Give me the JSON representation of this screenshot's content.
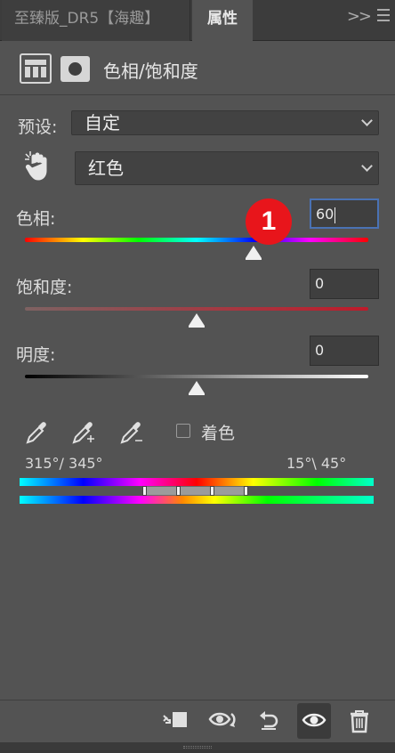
{
  "tabs": [
    {
      "label": "至臻版_DR5【海趣】",
      "active": false
    },
    {
      "label": "属性",
      "active": true
    }
  ],
  "tab_overflow": ">>",
  "panel": {
    "title": "色相/饱和度",
    "icons": [
      "adjustment-layer-icon",
      "layer-mask-icon"
    ]
  },
  "preset": {
    "label": "预设:",
    "value": "自定"
  },
  "channel": {
    "icon": "targeted-adjustment-hand-icon",
    "value": "红色"
  },
  "hue": {
    "label": "色相:",
    "value": "60",
    "level": 60,
    "range": [
      -180,
      180
    ]
  },
  "saturation": {
    "label": "饱和度:",
    "value": "0",
    "level": 0,
    "range": [
      -100,
      100
    ]
  },
  "lightness": {
    "label": "明度:",
    "value": "0",
    "level": 0,
    "range": [
      -100,
      100
    ]
  },
  "annotation_badge": "1",
  "tools": {
    "droppers": [
      "eyedropper-icon",
      "eyedropper-plus-icon",
      "eyedropper-minus-icon"
    ],
    "colorize_label": "着色",
    "colorize_checked": false
  },
  "color_range": {
    "left_text": "315°/ 345°",
    "right_text": "15°\\ 45°"
  },
  "toolbar": {
    "buttons": [
      "clip-to-layer-icon",
      "view-previous-icon",
      "reset-icon",
      "visibility-eye-icon",
      "trash-icon"
    ]
  },
  "colors": {
    "panel_bg": "#535353",
    "tab_bg": "#3c3c3c",
    "focus_border": "#4a72b4",
    "badge": "#e8151b"
  }
}
